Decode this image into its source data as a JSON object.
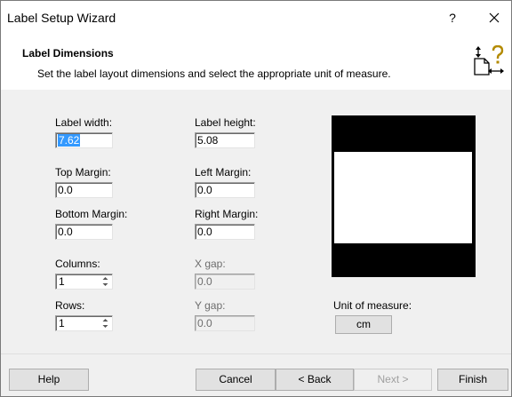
{
  "window": {
    "title": "Label Setup Wizard",
    "help_glyph": "?",
    "close_glyph": "×"
  },
  "header": {
    "title": "Label Dimensions",
    "description": "Set the label layout dimensions and select the appropriate unit of measure.",
    "icon": "label-dimensions-icon"
  },
  "fields": {
    "label_width": {
      "label": "Label width:",
      "value": "7.62"
    },
    "label_height": {
      "label": "Label height:",
      "value": "5.08"
    },
    "top_margin": {
      "label": "Top Margin:",
      "value": "0.0"
    },
    "left_margin": {
      "label": "Left Margin:",
      "value": "0.0"
    },
    "bottom_margin": {
      "label": "Bottom Margin:",
      "value": "0.0"
    },
    "right_margin": {
      "label": "Right Margin:",
      "value": "0.0"
    },
    "columns": {
      "label": "Columns:",
      "value": "1"
    },
    "x_gap": {
      "label": "X gap:",
      "value": "0.0"
    },
    "rows": {
      "label": "Rows:",
      "value": "1"
    },
    "y_gap": {
      "label": "Y gap:",
      "value": "0.0"
    }
  },
  "unit": {
    "label": "Unit of measure:",
    "value": "cm"
  },
  "buttons": {
    "help": "Help",
    "cancel": "Cancel",
    "back": "< Back",
    "next": "Next >",
    "finish": "Finish"
  },
  "colors": {
    "preview_background": "#000000",
    "preview_label": "#ffffff",
    "selection": "#3399ff"
  }
}
